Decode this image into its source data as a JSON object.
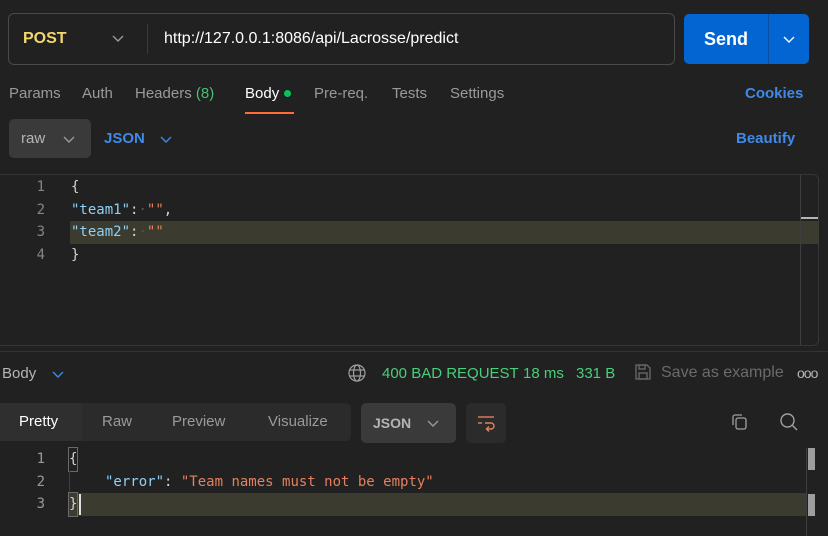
{
  "request": {
    "method": "POST",
    "url": "http://127.0.0.1:8086/api/Lacrosse/predict",
    "send_label": "Send"
  },
  "request_tabs": [
    {
      "label": "Params"
    },
    {
      "label": "Auth"
    },
    {
      "label": "Headers",
      "count": "(8)"
    },
    {
      "label": "Body",
      "active": true,
      "indicator": "green-dot"
    },
    {
      "label": "Pre-req."
    },
    {
      "label": "Tests"
    },
    {
      "label": "Settings"
    }
  ],
  "cookies_label": "Cookies",
  "body_mode": {
    "mode": "raw",
    "language": "JSON",
    "beautify_label": "Beautify"
  },
  "request_body": {
    "lines": [
      {
        "n": "1",
        "text": "{"
      },
      {
        "n": "2",
        "key": "\"team1\"",
        "sep": ":",
        "value": "\"\"",
        "trail": ","
      },
      {
        "n": "3",
        "key": "\"team2\"",
        "sep": ":",
        "value": "\"\"",
        "trail": ""
      },
      {
        "n": "4",
        "text": "}"
      }
    ],
    "highlighted_line": 3
  },
  "response": {
    "section_label": "Body",
    "status": "400 BAD REQUEST",
    "time": "18 ms",
    "size": "331 B",
    "save_label": "Save as example",
    "more_label": "ooo",
    "view_tabs": [
      {
        "label": "Pretty",
        "active": true
      },
      {
        "label": "Raw"
      },
      {
        "label": "Preview"
      },
      {
        "label": "Visualize"
      }
    ],
    "format": "JSON",
    "lines": [
      {
        "n": "1",
        "text": "{"
      },
      {
        "n": "2",
        "key": "\"error\"",
        "sep": ": ",
        "value": "\"Team names must not be empty\""
      },
      {
        "n": "3",
        "text": "}"
      }
    ],
    "highlighted_line": 3
  },
  "colors": {
    "method": "#f5d76e",
    "accent_blue": "#3f8ae8",
    "send_bg": "#0265d2",
    "status_green": "#4bce7a",
    "tab_underline": "#ff6c37",
    "json_key": "#8fd0f7",
    "json_string": "#e4805f"
  }
}
